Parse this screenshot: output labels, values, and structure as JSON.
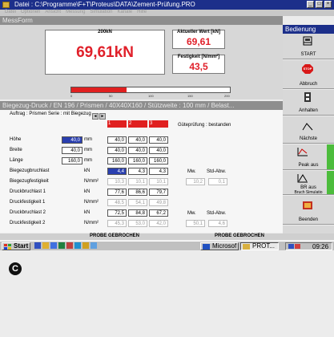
{
  "window": {
    "title": "Datei : C:\\Programme\\F+T\\Proteus\\DATA\\Zement-Prüfung.PRO",
    "buttons": [
      "_",
      "□",
      "×"
    ]
  },
  "menu": [
    "Datei",
    "Optionen",
    "Ansicht",
    "Messung",
    "Simulation",
    "Kanäle",
    "Hilfe"
  ],
  "messform": {
    "header": "MessForm",
    "force_caption": "200kN",
    "force_value": "69,61kN",
    "current_caption": "Aktueller Wert [kN]",
    "current_value": "69,61",
    "strength_caption": "Festigkeit [N/mm²]",
    "strength_value": "43,5",
    "progress_fraction": 0.35,
    "scale_ticks": [
      "0",
      "50",
      "100",
      "150",
      "200"
    ]
  },
  "bedienung": {
    "header": "Bedienung",
    "buttons": [
      {
        "label": "START",
        "icon": "machine-icon"
      },
      {
        "label": "Abbruch",
        "icon": "stop-icon",
        "icon_text": "STOP"
      },
      {
        "label": "Anhalten",
        "icon": "pause-icon"
      },
      {
        "label": "Nächste",
        "icon": "next-curve-icon"
      },
      {
        "label": "Peak aus",
        "icon": "peak-icon"
      },
      {
        "label": "BR aus",
        "icon": "break-icon",
        "sublabel": "Bruch Simulatio"
      },
      {
        "label": "Beenden",
        "icon": "exit-icon"
      }
    ]
  },
  "table": {
    "header": "Biegezug-Druck / EN 196 / Prismen / 40X40X160 / Stützweite : 100 mm / Belast...",
    "order": "Auftrag : Prismen  Serie : mit Biegezug",
    "quality": "Güteprüfung : bestanden",
    "nav": [
      "◄",
      "►"
    ],
    "columns": [
      "1",
      "2",
      "3"
    ],
    "stat_headers": [
      "Mw.",
      "Std-Abw."
    ],
    "rows": [
      {
        "label": "Höhe",
        "input": "40,0",
        "unit": "mm",
        "v": [
          "40,0",
          "40,0",
          "40,0"
        ],
        "sel": true
      },
      {
        "label": "Breite",
        "input": "40,0",
        "unit": "mm",
        "v": [
          "40,0",
          "40,0",
          "40,0"
        ]
      },
      {
        "label": "Länge",
        "input": "160,0",
        "unit": "mm",
        "v": [
          "160,0",
          "160,0",
          "160,0"
        ]
      },
      {
        "label": "Biegezugbruchlast",
        "unit": "kN",
        "v": [
          "4,4",
          "4,3",
          "4,3"
        ],
        "firstsel": true
      },
      {
        "label": "Biegezugfestigkeit",
        "unit": "N/mm²",
        "v": [
          "10,3",
          "10,1",
          "10,1"
        ],
        "grey": true,
        "mw": "10,2",
        "std": "0,1"
      },
      {
        "label": "Druckbruchlast 1",
        "unit": "kN",
        "v": [
          "77,6",
          "86,6",
          "79,7"
        ]
      },
      {
        "label": "Druckfestigkeit 1",
        "unit": "N/mm²",
        "v": [
          "48,5",
          "54,1",
          "49,8"
        ],
        "grey": true
      },
      {
        "label": "Druckbruchlast 2",
        "unit": "kN",
        "v": [
          "72,5",
          "84,8",
          "67,2"
        ]
      },
      {
        "label": "Druckfestigkeit 2",
        "unit": "N/mm²",
        "v": [
          "45,3",
          "53,0",
          "42,0"
        ],
        "grey": true,
        "mw": "50,1",
        "std": "4,6"
      }
    ]
  },
  "status": {
    "left": "PROBE GEBROCHEN",
    "right": "PROBE GEBROCHEN"
  },
  "taskbar": {
    "start": "Start",
    "task1": "Microsof",
    "task2": "PROT...",
    "time": "09:26"
  },
  "marker": "C"
}
